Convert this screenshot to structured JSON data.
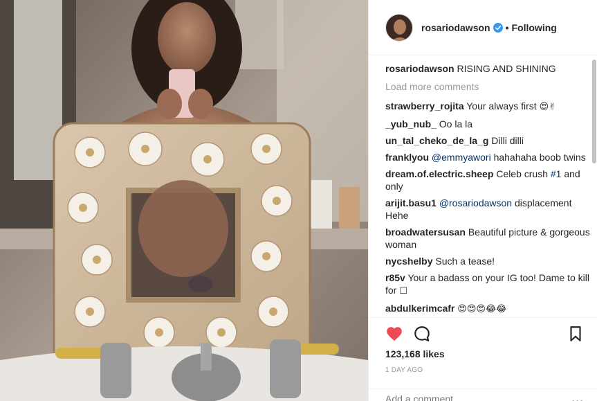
{
  "header": {
    "username": "rosariodawson",
    "dot": "•",
    "follow_status": "Following"
  },
  "caption": {
    "username": "rosariodawson",
    "text": "RISING AND SHINING"
  },
  "load_more_label": "Load more comments",
  "comments": [
    {
      "user": "strawberry_rojita",
      "text": "Your always first",
      "emoji": "😍✌"
    },
    {
      "user": "_yub_nub_",
      "text": "Oo la la"
    },
    {
      "user": "un_tal_cheko_de_la_g",
      "text": "Dilli dilli"
    },
    {
      "user": "franklyou",
      "mention": "@emmyawori",
      "text": "hahahaha boob twins"
    },
    {
      "user": "dream.of.electric.sheep",
      "text": "Celeb crush",
      "hashtag": "#1",
      "text_after": "and only"
    },
    {
      "user": "arijit.basu1",
      "mention": "@rosariodawson",
      "text": "displacement Hehe"
    },
    {
      "user": "broadwatersusan",
      "text": "Beautiful picture & gorgeous woman"
    },
    {
      "user": "nycshelby",
      "text": "Such a tease!"
    },
    {
      "user": "r85v",
      "text": "Your a badass on your IG too! Dame to kill for",
      "emoji": "☐"
    },
    {
      "user": "abdulkerimcafr",
      "emoji": "😍😍😍😂😂"
    }
  ],
  "likes": "123,168 likes",
  "age": "1 DAY AGO",
  "add_comment": {
    "placeholder": "Add a comment..."
  },
  "more_label": "•••",
  "icons": {
    "like": "heart-icon",
    "comment": "comment-bubble-icon",
    "save": "bookmark-icon",
    "verified": "verified-badge-icon",
    "more": "more-options-icon"
  },
  "colors": {
    "like_red": "#ed4956",
    "verified_blue": "#3897f0",
    "mention_blue": "#003569",
    "muted_gray": "#999999"
  }
}
